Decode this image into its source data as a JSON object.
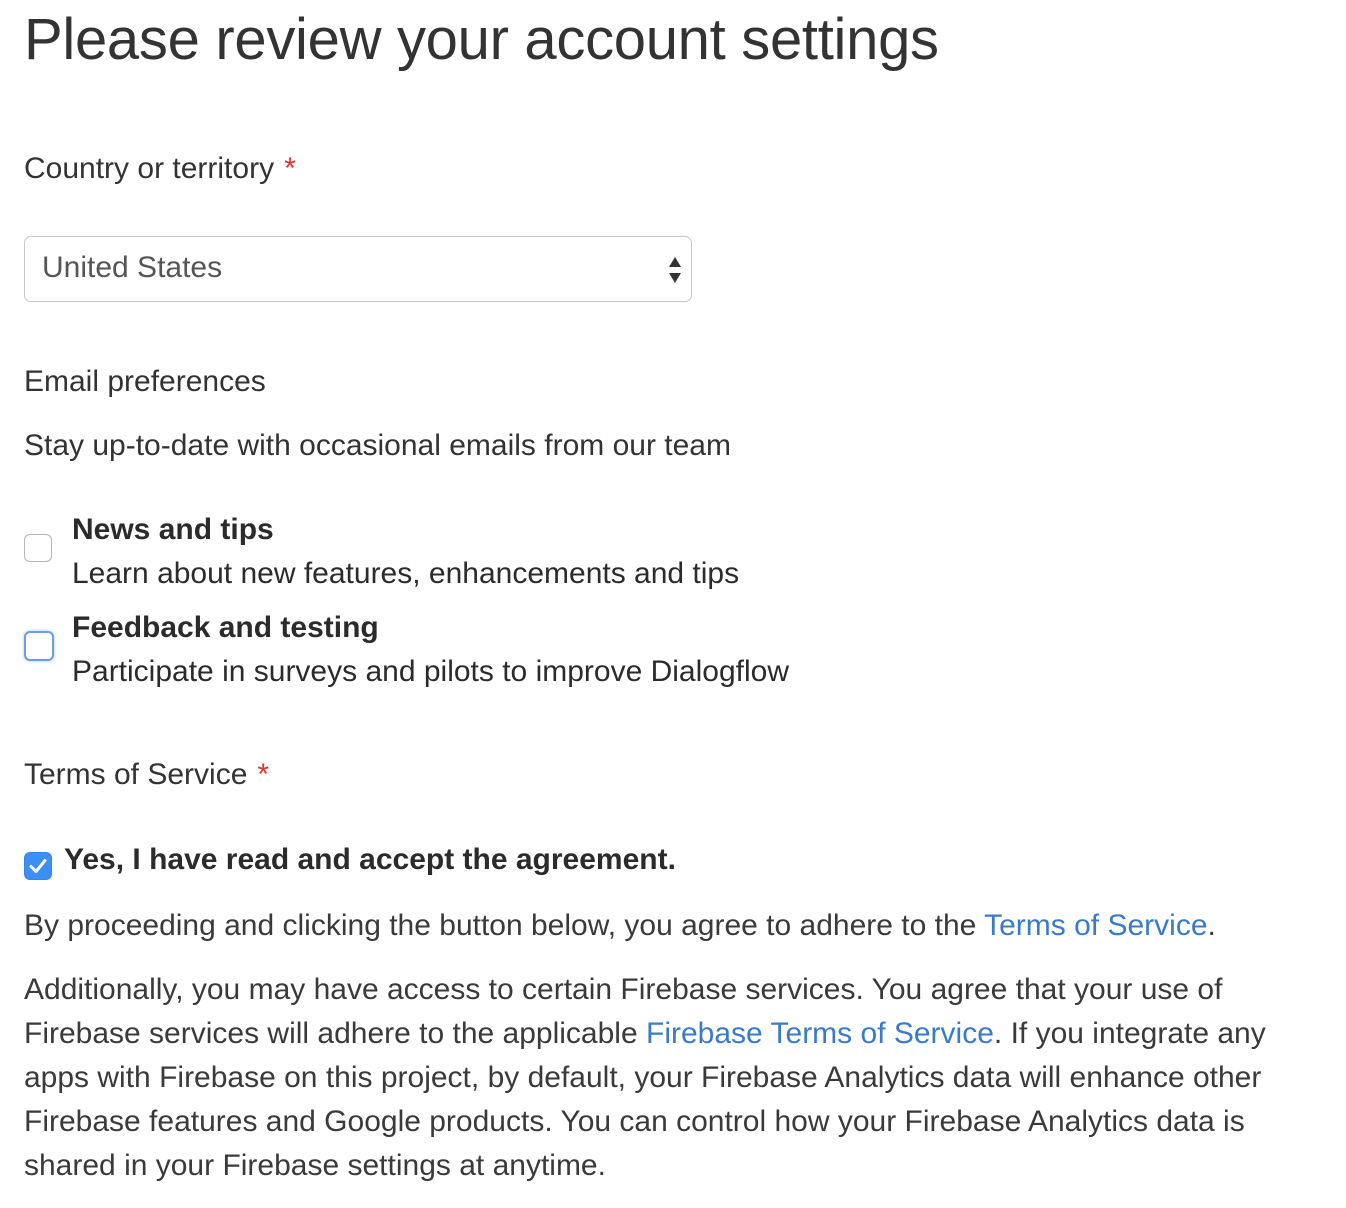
{
  "page": {
    "title": "Please review your account settings"
  },
  "country": {
    "label": "Country or territory",
    "required_marker": "*",
    "selected_value": "United States"
  },
  "email_preferences": {
    "heading": "Email preferences",
    "subtitle": "Stay up-to-date with occasional emails from our team",
    "options": [
      {
        "title": "News and tips",
        "description": "Learn about new features, enhancements and tips",
        "checked": false
      },
      {
        "title": "Feedback and testing",
        "description": "Participate in surveys and pilots to improve Dialogflow",
        "checked": false
      }
    ]
  },
  "terms": {
    "heading": "Terms of Service",
    "required_marker": "*",
    "accept_label": "Yes, I have read and accept the agreement.",
    "accept_checked": true,
    "proceed_text_before": "By proceeding and clicking the button below, you agree to adhere to the ",
    "proceed_link": "Terms of Service",
    "proceed_text_after": ".",
    "firebase_line1": "Additionally, you may have access to certain Firebase services. You agree that your use of",
    "firebase_line2_before": "Firebase services will adhere to the applicable ",
    "firebase_link": "Firebase Terms of Service",
    "firebase_line2_after": ". If you integrate any",
    "firebase_line3": "apps with Firebase on this project, by default, your Firebase Analytics data will enhance other",
    "firebase_line4": "Firebase features and Google products. You can control how your Firebase Analytics data is",
    "firebase_line5": "shared in your Firebase settings at anytime."
  },
  "colors": {
    "required": "#e0332f",
    "link": "#3a7bc8",
    "checkbox_checked": "#3d8ff3",
    "focus_ring": "#6d9fdc"
  }
}
